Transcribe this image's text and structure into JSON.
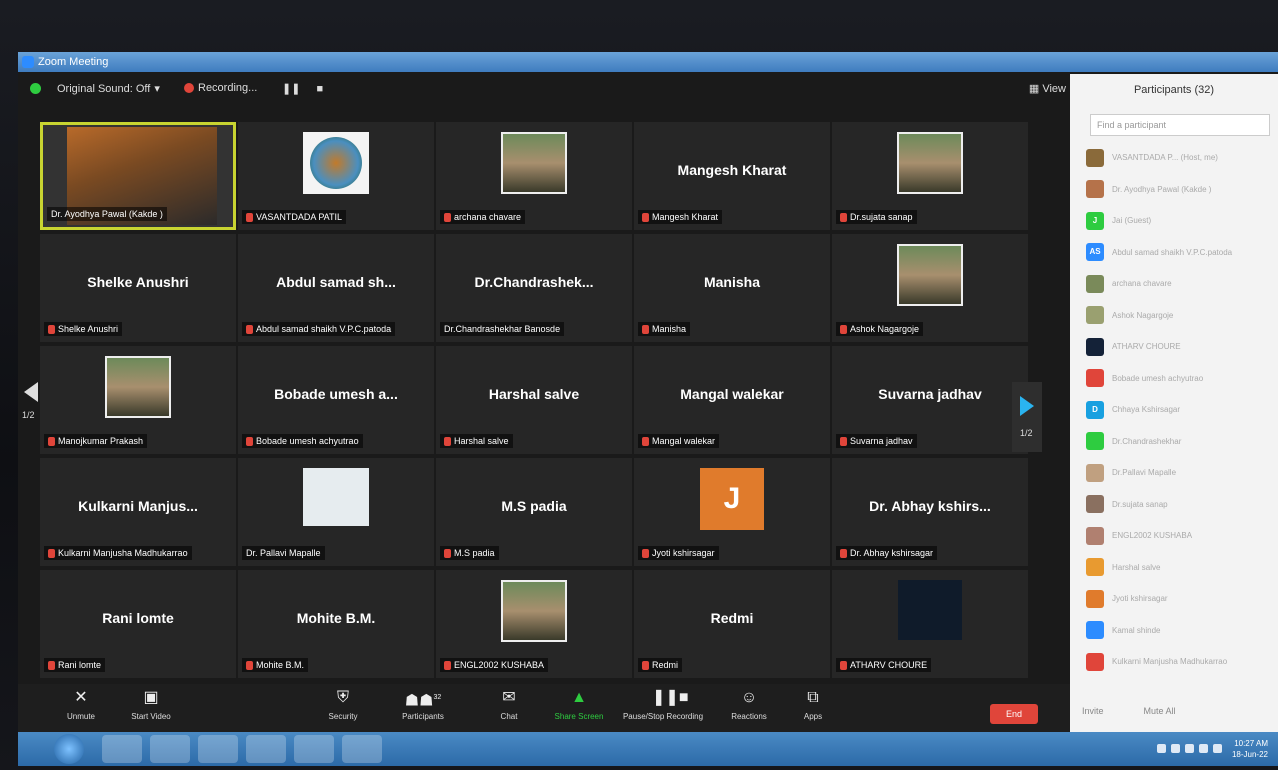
{
  "window": {
    "title": "Zoom Meeting"
  },
  "top_toolbar": {
    "original_sound": "Original Sound: Off",
    "recording": "Recording...",
    "view_label": "View"
  },
  "pager": {
    "left": "1/2",
    "right": "1/2"
  },
  "tiles": [
    {
      "big": "",
      "label": "Dr. Ayodhya Pawal (Kakde )",
      "kind": "large-photo",
      "active": true,
      "muted": false
    },
    {
      "big": "",
      "label": "VASANTDADA PATIL",
      "kind": "logo",
      "muted": true
    },
    {
      "big": "",
      "label": "archana chavare",
      "kind": "person",
      "muted": true
    },
    {
      "big": "Mangesh Kharat",
      "label": "Mangesh Kharat",
      "kind": "name",
      "muted": true
    },
    {
      "big": "",
      "label": "Dr.sujata sanap",
      "kind": "person",
      "muted": true
    },
    {
      "big": "Shelke Anushri",
      "label": "Shelke Anushri",
      "kind": "name",
      "muted": true
    },
    {
      "big": "Abdul samad sh...",
      "label": "Abdul samad shaikh V.P.C.patoda",
      "kind": "name",
      "muted": true
    },
    {
      "big": "Dr.Chandrashek...",
      "label": "Dr.Chandrashekhar Banosde",
      "kind": "name",
      "muted": false
    },
    {
      "big": "Manisha",
      "label": "Manisha",
      "kind": "name",
      "muted": true
    },
    {
      "big": "",
      "label": "Ashok Nagargoje",
      "kind": "person",
      "muted": true
    },
    {
      "big": "",
      "label": "Manojkumar Prakash",
      "kind": "person",
      "muted": true
    },
    {
      "big": "Bobade umesh a...",
      "label": "Bobade umesh achyutrao",
      "kind": "name",
      "muted": true
    },
    {
      "big": "Harshal salve",
      "label": "Harshal salve",
      "kind": "name",
      "muted": true
    },
    {
      "big": "Mangal walekar",
      "label": "Mangal walekar",
      "kind": "name",
      "muted": true
    },
    {
      "big": "Suvarna jadhav",
      "label": "Suvarna jadhav",
      "kind": "name",
      "muted": true
    },
    {
      "big": "Kulkarni  Manjus...",
      "label": "Kulkarni Manjusha Madhukarrao",
      "kind": "name",
      "muted": true
    },
    {
      "big": "",
      "label": "Dr. Pallavi Mapalle",
      "kind": "doc",
      "muted": false
    },
    {
      "big": "M.S padia",
      "label": "M.S padia",
      "kind": "name",
      "muted": true
    },
    {
      "big": "J",
      "label": "Jyoti kshirsagar",
      "kind": "initial",
      "muted": true
    },
    {
      "big": "Dr. Abhay kshirs...",
      "label": "Dr. Abhay kshirsagar",
      "kind": "name",
      "muted": true
    },
    {
      "big": "Rani lomte",
      "label": "Rani lomte",
      "kind": "name",
      "muted": true
    },
    {
      "big": "Mohite B.M.",
      "label": "Mohite B.M.",
      "kind": "name",
      "muted": true
    },
    {
      "big": "",
      "label": "ENGL2002 KUSHABA",
      "kind": "person",
      "muted": true
    },
    {
      "big": "Redmi",
      "label": "Redmi",
      "kind": "name",
      "muted": true
    },
    {
      "big": "",
      "label": "ATHARV CHOURE",
      "kind": "dark",
      "muted": true
    }
  ],
  "bottom_toolbar": {
    "unmute": "Unmute",
    "start_video": "Start Video",
    "security": "Security",
    "participants": "Participants",
    "participants_count": "32",
    "chat": "Chat",
    "share_screen": "Share Screen",
    "pause_recording": "Pause/Stop Recording",
    "reactions": "Reactions",
    "apps": "Apps",
    "end": "End"
  },
  "participants_panel": {
    "title": "Participants (32)",
    "search_placeholder": "Find a participant",
    "footer_invite": "Invite",
    "footer_mute_all": "Mute All",
    "rows": [
      {
        "name": "VASANTDADA P... (Host, me)",
        "avatar": "",
        "color": "#8a6a3a"
      },
      {
        "name": "Dr. Ayodhya Pawal (Kakde )",
        "avatar": "",
        "color": "#b5724a"
      },
      {
        "name": "Jai (Guest)",
        "avatar": "J",
        "color": "#2ecc40"
      },
      {
        "name": "Abdul samad shaikh V.P.C.patoda",
        "avatar": "AS",
        "color": "#2d8cff"
      },
      {
        "name": "archana chavare",
        "avatar": "",
        "color": "#7a8a5a"
      },
      {
        "name": "Ashok Nagargoje",
        "avatar": "",
        "color": "#9aa070"
      },
      {
        "name": "ATHARV CHOURE",
        "avatar": "",
        "color": "#142238"
      },
      {
        "name": "Bobade umesh achyutrao",
        "avatar": "",
        "color": "#e0453a"
      },
      {
        "name": "Chhaya Kshirsagar",
        "avatar": "D",
        "color": "#18a0e0"
      },
      {
        "name": "Dr.Chandrashekhar",
        "avatar": "",
        "color": "#2ecc40"
      },
      {
        "name": "Dr.Pallavi Mapalle",
        "avatar": "",
        "color": "#c0a080"
      },
      {
        "name": "Dr.sujata sanap",
        "avatar": "",
        "color": "#8a7060"
      },
      {
        "name": "ENGL2002 KUSHABA",
        "avatar": "",
        "color": "#b08070"
      },
      {
        "name": "Harshal salve",
        "avatar": "",
        "color": "#e89a30"
      },
      {
        "name": "Jyoti kshirsagar",
        "avatar": "",
        "color": "#e07b2c"
      },
      {
        "name": "Kamal shinde",
        "avatar": "",
        "color": "#2d8cff"
      },
      {
        "name": "Kulkarni Manjusha Madhukarrao",
        "avatar": "",
        "color": "#e0453a"
      }
    ]
  },
  "taskbar": {
    "time": "10:27 AM",
    "date": "18-Jun-22"
  }
}
